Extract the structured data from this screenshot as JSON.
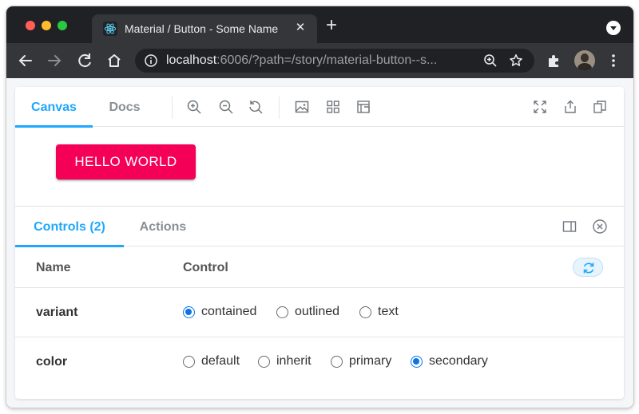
{
  "browser": {
    "tab_title": "Material / Button - Some Name",
    "url_host": "localhost",
    "url_rest": ":6006/?path=/story/material-button--s..."
  },
  "storybook": {
    "tabs": [
      "Canvas",
      "Docs"
    ],
    "active_tab": "Canvas"
  },
  "preview": {
    "button_label": "HELLO WORLD",
    "button_color": "#f50057"
  },
  "addons": {
    "tabs": [
      "Controls (2)",
      "Actions"
    ],
    "active_tab": "Controls (2)",
    "header": {
      "name": "Name",
      "control": "Control"
    },
    "controls": [
      {
        "name": "variant",
        "options": [
          "contained",
          "outlined",
          "text"
        ],
        "selected": "contained"
      },
      {
        "name": "color",
        "options": [
          "default",
          "inherit",
          "primary",
          "secondary"
        ],
        "selected": "secondary"
      }
    ]
  },
  "colors": {
    "accent": "#1ea7fd",
    "radio_checked": "#0b74e8",
    "chrome_dark": "#202124"
  }
}
